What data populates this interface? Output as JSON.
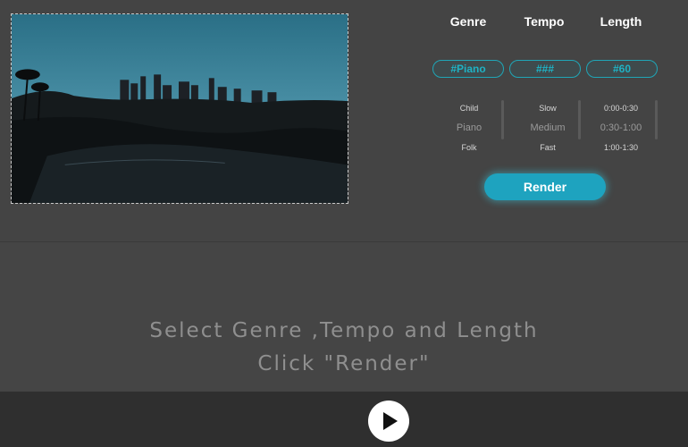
{
  "media": {
    "description_icon": "city-skyline-photo"
  },
  "columns": [
    {
      "header": "Genre",
      "tag": "#Piano",
      "options": [
        "Child",
        "Piano",
        "Folk"
      ],
      "selected_index": 1
    },
    {
      "header": "Tempo",
      "tag": "###",
      "options": [
        "Slow",
        "Medium",
        "Fast"
      ],
      "selected_index": 1
    },
    {
      "header": "Length",
      "tag": "#60",
      "options": [
        "0:00-0:30",
        "0:30-1:00",
        "1:00-1:30"
      ],
      "selected_index": 1
    }
  ],
  "render_button": {
    "label": "Render"
  },
  "instruction": {
    "line1": "Select Genre ,Tempo and Length",
    "line2": "Click \"Render\""
  },
  "player": {
    "icon": "play-icon"
  },
  "colors": {
    "accent": "#1ea3bf",
    "background": "#454545",
    "player_bar": "#2f2f2f"
  }
}
